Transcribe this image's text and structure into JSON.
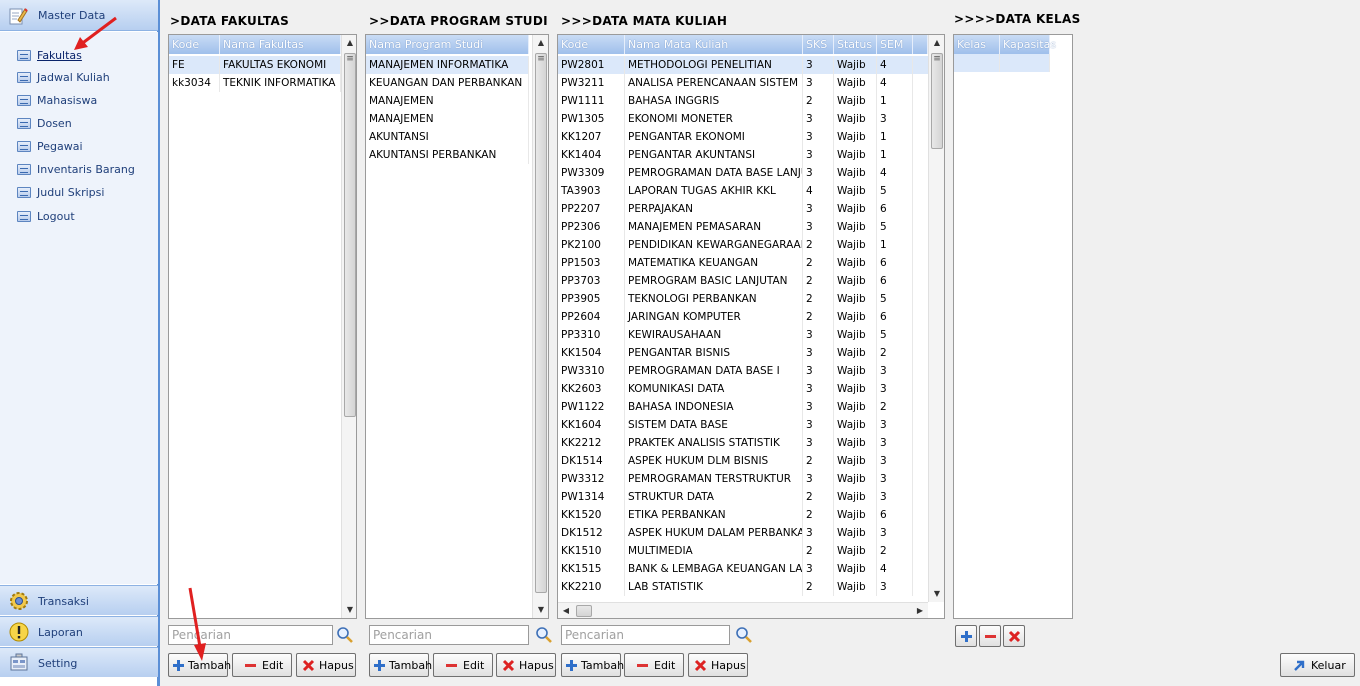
{
  "sidebar": {
    "master_label": "Master Data",
    "items": [
      {
        "label": "Fakultas",
        "active": true
      },
      {
        "label": "Jadwal Kuliah"
      },
      {
        "label": "Mahasiswa"
      },
      {
        "label": "Dosen"
      },
      {
        "label": "Pegawai"
      },
      {
        "label": "Inventaris Barang"
      },
      {
        "label": "Judul Skripsi"
      },
      {
        "label": "Logout"
      }
    ],
    "bottom": [
      {
        "label": "Transaksi",
        "icon": "gear-icon"
      },
      {
        "label": "Laporan",
        "icon": "warning-icon"
      },
      {
        "label": "Setting",
        "icon": "settings-icon"
      }
    ]
  },
  "fakultas": {
    "title": ">DATA FAKULTAS",
    "columns": [
      "Kode",
      "Nama Fakultas"
    ],
    "rows": [
      [
        "FE",
        "FAKULTAS EKONOMI"
      ],
      [
        "kk3034",
        "TEKNIK INFORMATIKA"
      ]
    ],
    "search_placeholder": "Pencarian",
    "buttons": {
      "add": "Tambah",
      "edit": "Edit",
      "delete": "Hapus"
    }
  },
  "prodi": {
    "title": ">>DATA PROGRAM STUDI",
    "columns": [
      "Nama Program Studi"
    ],
    "rows": [
      "MANAJEMEN INFORMATIKA",
      "KEUANGAN DAN PERBANKAN",
      "MANAJEMEN",
      "MANAJEMEN",
      "AKUNTANSI",
      "AKUNTANSI PERBANKAN"
    ],
    "search_placeholder": "Pencarian",
    "buttons": {
      "add": "Tambah",
      "edit": "Edit",
      "delete": "Hapus"
    }
  },
  "matkul": {
    "title": ">>>DATA MATA KULIAH",
    "columns": [
      "Kode",
      "Nama Mata Kuliah",
      "SKS",
      "Status",
      "SEM"
    ],
    "rows": [
      [
        "PW2801",
        "METHODOLOGI PENELITIAN",
        "3",
        "Wajib",
        "4"
      ],
      [
        "PW3211",
        "ANALISA PERENCANAAN SISTEM",
        "3",
        "Wajib",
        "4"
      ],
      [
        "PW1111",
        "BAHASA INGGRIS",
        "2",
        "Wajib",
        "1"
      ],
      [
        "PW1305",
        "EKONOMI MONETER",
        "3",
        "Wajib",
        "3"
      ],
      [
        "KK1207",
        "PENGANTAR EKONOMI",
        "3",
        "Wajib",
        "1"
      ],
      [
        "KK1404",
        "PENGANTAR AKUNTANSI",
        "3",
        "Wajib",
        "1"
      ],
      [
        "PW3309",
        "PEMROGRAMAN DATA BASE LANJUTAN",
        "3",
        "Wajib",
        "4"
      ],
      [
        "TA3903",
        "LAPORAN TUGAS AKHIR  KKL",
        "4",
        "Wajib",
        "5"
      ],
      [
        "PP2207",
        "PERPAJAKAN",
        "3",
        "Wajib",
        "6"
      ],
      [
        "PP2306",
        "MANAJEMEN PEMASARAN",
        "3",
        "Wajib",
        "5"
      ],
      [
        "PK2100",
        "PENDIDIKAN KEWARGANEGARAAN",
        "2",
        "Wajib",
        "1"
      ],
      [
        "PP1503",
        "MATEMATIKA KEUANGAN",
        "2",
        "Wajib",
        "6"
      ],
      [
        "PP3703",
        "PEMROGRAM BASIC LANJUTAN",
        "2",
        "Wajib",
        "6"
      ],
      [
        "PP3905",
        "TEKNOLOGI PERBANKAN",
        "2",
        "Wajib",
        "5"
      ],
      [
        "PP2604",
        "JARINGAN KOMPUTER",
        "2",
        "Wajib",
        "6"
      ],
      [
        "PP3310",
        "KEWIRAUSAHAAN",
        "3",
        "Wajib",
        "5"
      ],
      [
        "KK1504",
        "PENGANTAR BISNIS",
        "3",
        "Wajib",
        "2"
      ],
      [
        "PW3310",
        "PEMROGRAMAN DATA BASE I",
        "3",
        "Wajib",
        "3"
      ],
      [
        "KK2603",
        "KOMUNIKASI DATA",
        "3",
        "Wajib",
        "3"
      ],
      [
        "PW1122",
        "BAHASA INDONESIA",
        "3",
        "Wajib",
        "2"
      ],
      [
        "KK1604",
        "SISTEM DATA BASE",
        "3",
        "Wajib",
        "3"
      ],
      [
        "KK2212",
        "PRAKTEK ANALISIS STATISTIK",
        "3",
        "Wajib",
        "3"
      ],
      [
        "DK1514",
        "ASPEK HUKUM DLM BISNIS",
        "2",
        "Wajib",
        "3"
      ],
      [
        "PW3312",
        "PEMROGRAMAN TERSTRUKTUR",
        "3",
        "Wajib",
        "3"
      ],
      [
        "PW1314",
        "STRUKTUR DATA",
        "2",
        "Wajib",
        "3"
      ],
      [
        "KK1520",
        "ETIKA PERBANKAN",
        "2",
        "Wajib",
        "6"
      ],
      [
        "DK1512",
        "ASPEK HUKUM DALAM PERBANKAN",
        "3",
        "Wajib",
        "3"
      ],
      [
        "KK1510",
        "MULTIMEDIA",
        "2",
        "Wajib",
        "2"
      ],
      [
        "KK1515",
        "BANK & LEMBAGA KEUANGAN LAINNYA",
        "3",
        "Wajib",
        "4"
      ],
      [
        "KK2210",
        "LAB STATISTIK",
        "2",
        "Wajib",
        "3"
      ]
    ],
    "search_placeholder": "Pencarian",
    "buttons": {
      "add": "Tambah",
      "edit": "Edit",
      "delete": "Hapus"
    }
  },
  "kelas": {
    "title": ">>>>DATA KELAS",
    "columns": [
      "Kelas",
      "Kapasitas"
    ],
    "rows": []
  },
  "exit_label": "Keluar"
}
